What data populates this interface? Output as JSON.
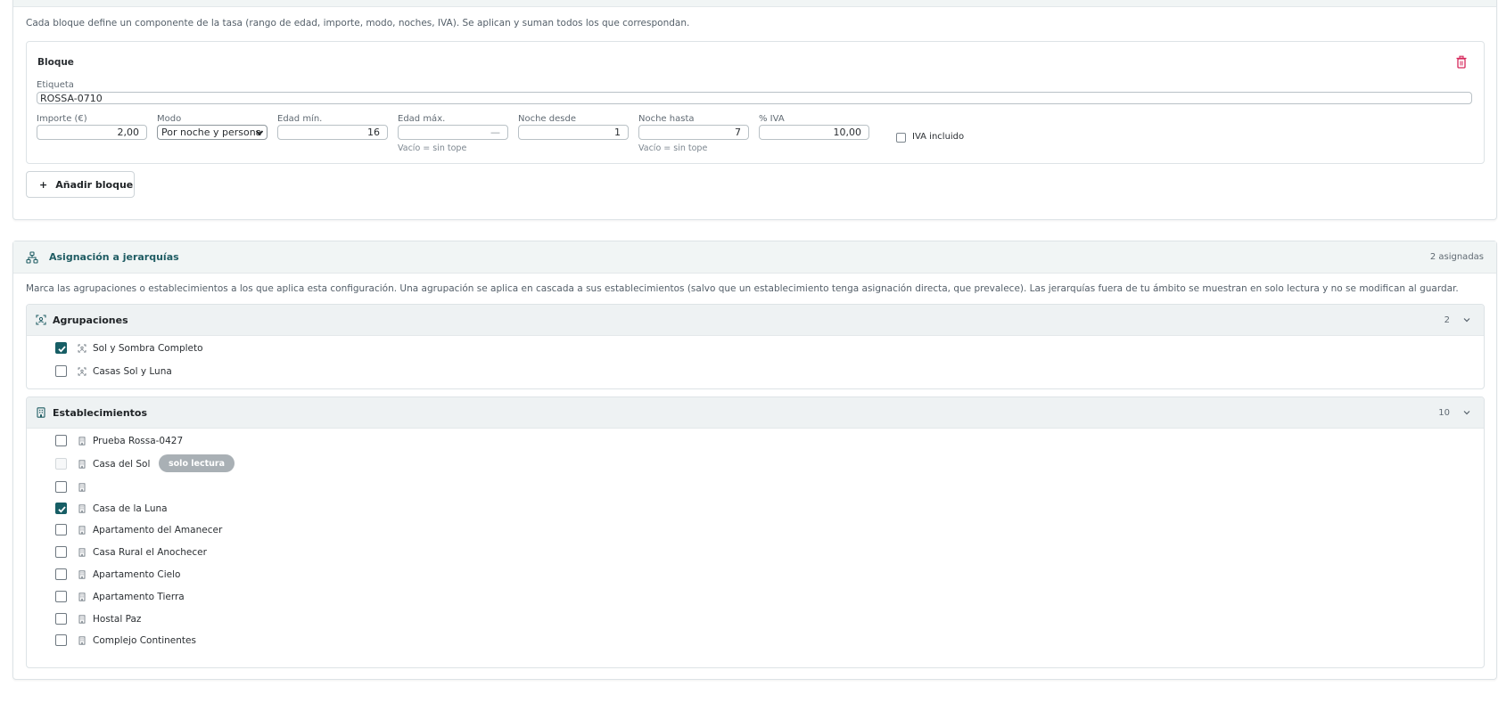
{
  "tarifas": {
    "description": "Cada bloque define un componente de la tasa (rango de edad, importe, modo, noches, IVA). Se aplican y suman todos los que correspondan.",
    "bloque": {
      "title": "Bloque",
      "etiqueta_label": "Etiqueta",
      "etiqueta_value": "ROSSA-0710",
      "importe_label": "Importe (€)",
      "importe_value": "2,00",
      "modo_label": "Modo",
      "modo_value": "Por noche y persona",
      "edad_min_label": "Edad mín.",
      "edad_min_value": "16",
      "edad_max_label": "Edad máx.",
      "edad_max_value": "—",
      "edad_max_hint": "Vacío = sin tope",
      "noche_desde_label": "Noche desde",
      "noche_desde_value": "1",
      "noche_hasta_label": "Noche hasta",
      "noche_hasta_value": "7",
      "noche_hasta_hint": "Vacío = sin tope",
      "iva_label": "% IVA",
      "iva_value": "10,00",
      "iva_incluido_label": "IVA incluido",
      "iva_incluido_checked": false
    },
    "add_block_label": "Añadir bloque"
  },
  "jerarquias": {
    "title": "Asignación a jerarquías",
    "count_label": "2 asignadas",
    "description": "Marca las agrupaciones o establecimientos a los que aplica esta configuración. Una agrupación se aplica en cascada a sus establecimientos (salvo que un establecimiento tenga asignación directa, que prevalece). Las jerarquías fuera de tu ámbito se muestran en solo lectura y no se modifican al guardar.",
    "agrupaciones": {
      "title": "Agrupaciones",
      "count": "2",
      "items": [
        {
          "label": "Sol y Sombra Completo",
          "checked": true
        },
        {
          "label": "Casas Sol y Luna",
          "checked": false
        }
      ]
    },
    "establecimientos": {
      "title": "Establecimientos",
      "count": "10",
      "readonly_badge": "solo lectura",
      "items": [
        {
          "label": "Prueba Rossa-0427",
          "checked": false
        },
        {
          "label": "Casa del Sol",
          "checked": false,
          "readonly": true
        },
        {
          "label": "",
          "checked": false
        },
        {
          "label": "Casa de la Luna",
          "checked": true
        },
        {
          "label": "Apartamento del Amanecer",
          "checked": false
        },
        {
          "label": "Casa Rural el Anochecer",
          "checked": false
        },
        {
          "label": "Apartamento Cielo",
          "checked": false
        },
        {
          "label": "Apartamento Tierra",
          "checked": false
        },
        {
          "label": "Hostal Paz",
          "checked": false
        },
        {
          "label": "Complejo Continentes",
          "checked": false
        }
      ]
    }
  },
  "colors": {
    "accent": "#175e65",
    "danger": "#d6275a",
    "badge": "#a9b0b5"
  },
  "icons": {
    "delete": "trash-icon",
    "add": "plus-icon",
    "hierarchy": "hierarchy-icon",
    "group": "group-icon",
    "building": "building-icon",
    "collapse": "chevron-down-icon"
  }
}
